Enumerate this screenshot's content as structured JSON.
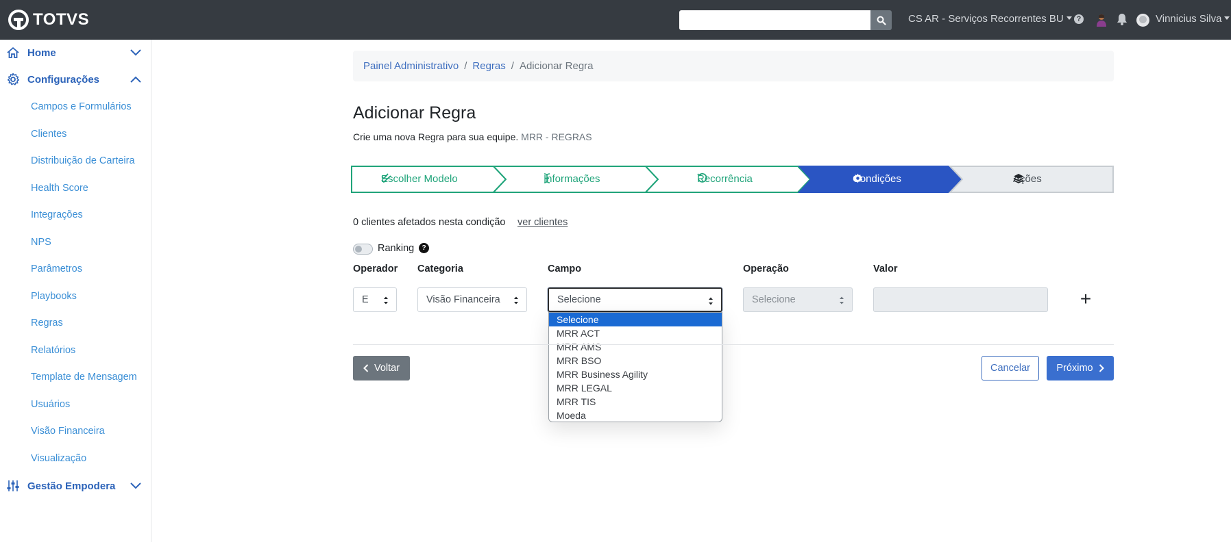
{
  "topbar": {
    "brand": "TOTVS",
    "search": {
      "value": "",
      "placeholder": ""
    },
    "workspace": "CS AR - Serviços Recorrentes BU",
    "help": "?",
    "user": "Vinnicius Silva"
  },
  "sidebar": {
    "groups": [
      {
        "label": "Home",
        "icon": "home-icon",
        "expanded": false
      },
      {
        "label": "Configurações",
        "icon": "gear-icon",
        "expanded": true
      },
      {
        "label": "Gestão Empodera",
        "icon": "sliders-icon",
        "expanded": false
      }
    ],
    "items": [
      "Campos e Formulários",
      "Clientes",
      "Distribuição de Carteira",
      "Health Score",
      "Integrações",
      "NPS",
      "Parâmetros",
      "Playbooks",
      "Regras",
      "Relatórios",
      "Template de Mensagem",
      "Usuários",
      "Visão Financeira",
      "Visualização"
    ]
  },
  "breadcrumb": [
    "Painel Administrativo",
    "Regras",
    "Adicionar Regra"
  ],
  "page": {
    "title": "Adicionar Regra",
    "subtitle": "Crie uma nova Regra para sua equipe.",
    "subtitle_tag": "MRR - REGRAS"
  },
  "stepper": {
    "steps": [
      {
        "label": "Escolher Modelo",
        "state": "done",
        "icon": "check-double-icon"
      },
      {
        "label": "Informações",
        "state": "done",
        "icon": "text-cursor-icon"
      },
      {
        "label": "Recorrência",
        "state": "done",
        "icon": "undo-icon"
      },
      {
        "label": "Condições",
        "state": "active",
        "icon": "gear-icon"
      },
      {
        "label": "Ações",
        "state": "pending",
        "icon": "layers-icon"
      }
    ],
    "colors": {
      "done": "#20a47a",
      "active": "#2a55c3",
      "pending": "#e9ecef"
    }
  },
  "conditions": {
    "affected_text": "0 clientes afetados nesta condição",
    "view_link": "ver clientes",
    "ranking_label": "Ranking",
    "ranking_help": "?",
    "ranking_on": false,
    "columns": [
      "Operador",
      "Categoria",
      "Campo",
      "Operação",
      "Valor"
    ],
    "operator_value": "E",
    "category_value": "Visão Financeira",
    "field_value": "Selecione",
    "operation_value": "Selecione",
    "value_value": "",
    "add_symbol": "+",
    "field_options": [
      "Selecione",
      "MRR ACT",
      "MRR AMS",
      "MRR BSO",
      "MRR Business Agility",
      "MRR LEGAL",
      "MRR TIS",
      "Moeda"
    ]
  },
  "footer": {
    "back": "Voltar",
    "cancel": "Cancelar",
    "next": "Próximo"
  }
}
